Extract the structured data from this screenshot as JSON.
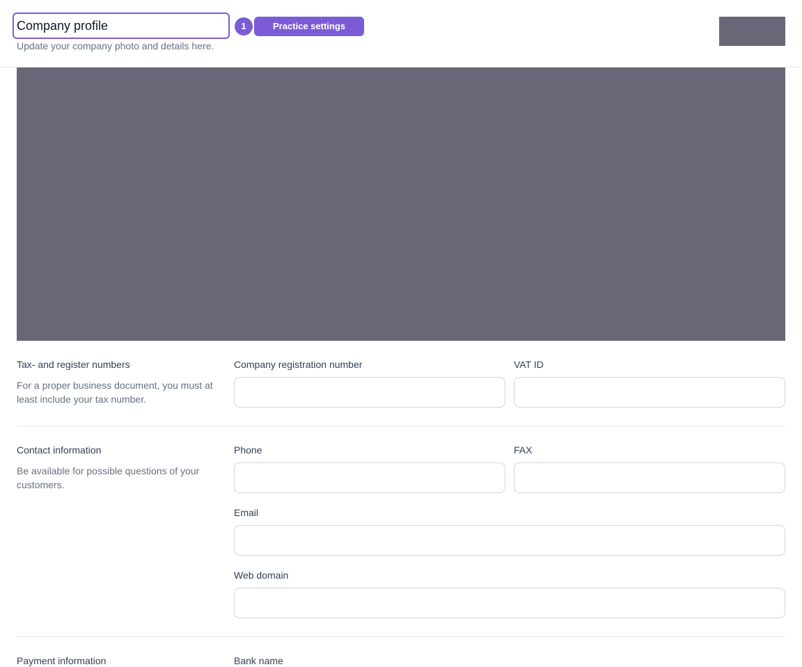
{
  "header": {
    "title": "Company profile",
    "subtitle": "Update your company photo and details here.",
    "step_number": "1",
    "practice_button_label": "Practice settings",
    "accent_color": "#7c5cd6"
  },
  "sections": {
    "tax": {
      "title": "Tax- and register numbers",
      "description": "For a proper business document, you must at least include your tax number.",
      "fields": {
        "registration_label": "Company registration number",
        "registration_value": "",
        "vat_label": "VAT ID",
        "vat_value": ""
      }
    },
    "contact": {
      "title": "Contact information",
      "description": "Be available for possible questions of your customers.",
      "fields": {
        "phone_label": "Phone",
        "phone_value": "",
        "fax_label": "FAX",
        "fax_value": "",
        "email_label": "Email",
        "email_value": "",
        "web_label": "Web domain",
        "web_value": ""
      }
    },
    "payment": {
      "title": "Payment information",
      "fields": {
        "bank_label": "Bank name"
      }
    }
  }
}
